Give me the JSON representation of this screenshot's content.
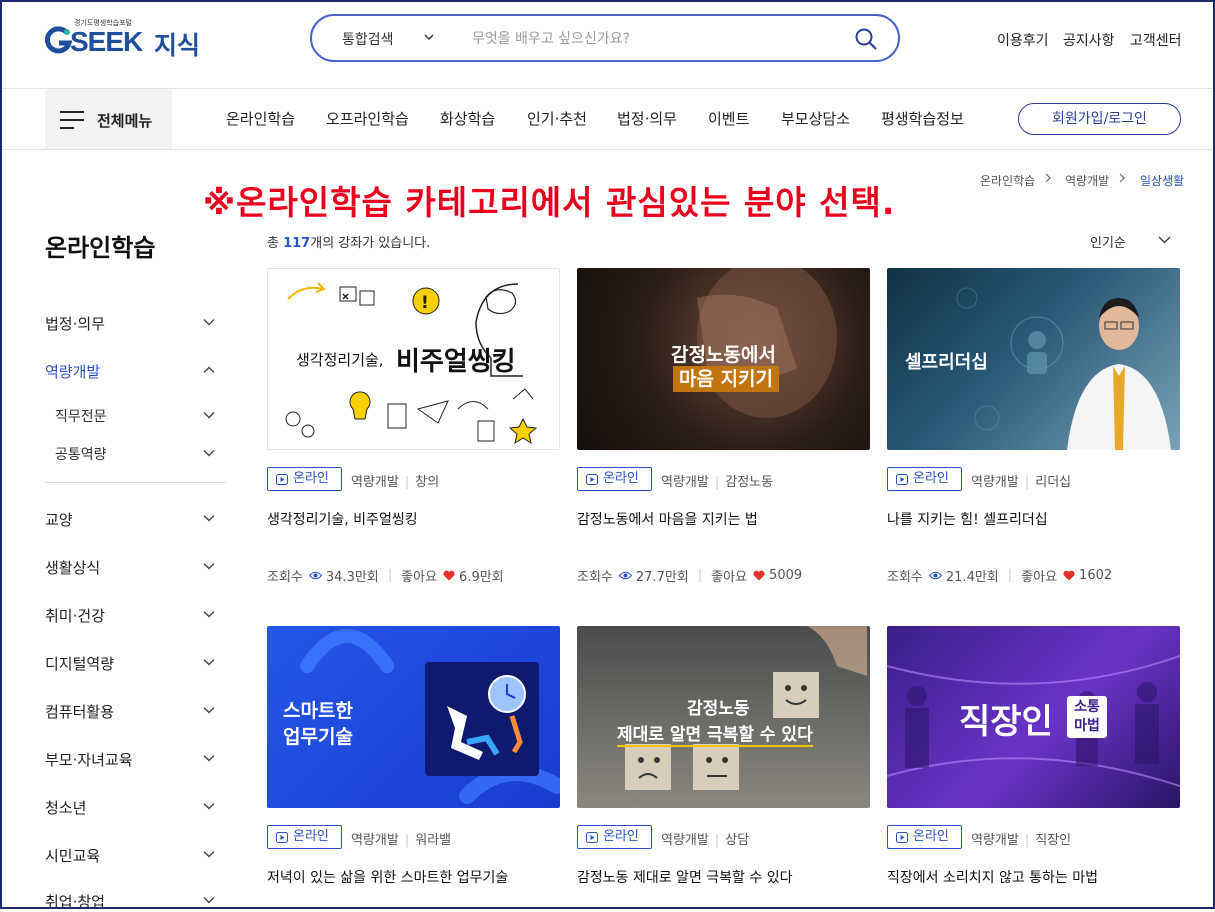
{
  "header": {
    "logo_small": "경기도평생학습포털",
    "logo_main": "SEEK",
    "logo_sub": "지식",
    "search_category": "통합검색",
    "search_placeholder": "무엇을 배우고 싶으신가요?",
    "top_links": [
      "이용후기",
      "공지사항",
      "고객센터"
    ]
  },
  "nav": {
    "all_menu": "전체메뉴",
    "items": [
      "온라인학습",
      "오프라인학습",
      "화상학습",
      "인기·추천",
      "법정·의무",
      "이벤트",
      "부모상담소",
      "평생학습정보"
    ],
    "login": "회원가입/로그인"
  },
  "notice": "※온라인학습 카테고리에서 관심있는 분야 선택.",
  "breadcrumb": [
    "온라인학습",
    "역량개발",
    "일상생활"
  ],
  "sidebar": {
    "title": "온라인학습",
    "items": [
      "법정·의무",
      "역량개발",
      "직무전문",
      "공통역량",
      "교양",
      "생활상식",
      "취미·건강",
      "디지털역량",
      "컴퓨터활용",
      "부모·자녀교육",
      "청소년",
      "시민교육",
      "취업·창업"
    ]
  },
  "list": {
    "count_prefix": "총 ",
    "count": "117",
    "count_suffix": "개의 강좌가 있습니다.",
    "sort": "인기순"
  },
  "labels": {
    "views": "조회수",
    "likes": "좋아요"
  },
  "cards": [
    {
      "badge": "온라인",
      "cat": "역량개발",
      "sub": "창의",
      "title": "생각정리기술, 비주얼씽킹",
      "views": "34.3만회",
      "likes": "6.9만회",
      "thumb": [
        "생각정리기술,",
        "비주얼씽킹"
      ]
    },
    {
      "badge": "온라인",
      "cat": "역량개발",
      "sub": "감정노동",
      "title": "감정노동에서 마음을 지키는 법",
      "views": "27.7만회",
      "likes": "5009",
      "thumb": [
        "감정노동에서",
        "마음 지키기"
      ]
    },
    {
      "badge": "온라인",
      "cat": "역량개발",
      "sub": "리더십",
      "title": "나를 지키는 힘! 셀프리더십",
      "views": "21.4만회",
      "likes": "1602",
      "thumb": [
        "셀프리더십"
      ]
    },
    {
      "badge": "온라인",
      "cat": "역량개발",
      "sub": "워라밸",
      "title": "저녁이 있는 삶을 위한 스마트한 업무기술",
      "thumb": [
        "스마트한",
        "업무기술"
      ]
    },
    {
      "badge": "온라인",
      "cat": "역량개발",
      "sub": "상담",
      "title": "감정노동 제대로 알면 극복할 수 있다",
      "thumb": [
        "감정노동",
        "제대로 알면 극복할 수 있다"
      ]
    },
    {
      "badge": "온라인",
      "cat": "역량개발",
      "sub": "직장인",
      "title": "직장에서 소리치지 않고 통하는 마법",
      "thumb": [
        "직장인",
        "소통",
        "마법"
      ]
    }
  ],
  "colors": {
    "accent": "#2b52c9",
    "brand": "#1e4e9c",
    "notice": "#e8001c",
    "heart": "#e8302a"
  }
}
